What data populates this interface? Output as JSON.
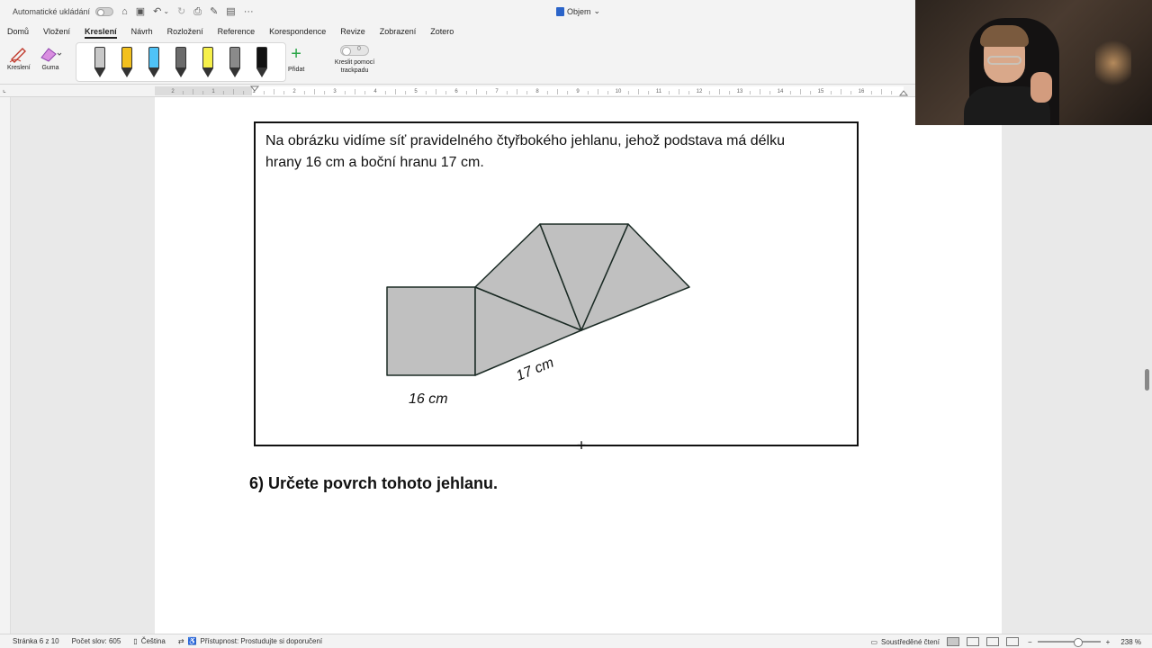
{
  "titlebar": {
    "autosave_label": "Automatické ukládání",
    "more_label": "···",
    "document_title": "Objem",
    "document_title_chevron": "⌄"
  },
  "tabs": [
    {
      "label": "Domů"
    },
    {
      "label": "Vložení"
    },
    {
      "label": "Kreslení",
      "active": true
    },
    {
      "label": "Návrh"
    },
    {
      "label": "Rozložení"
    },
    {
      "label": "Reference"
    },
    {
      "label": "Korespondence"
    },
    {
      "label": "Revize"
    },
    {
      "label": "Zobrazení"
    },
    {
      "label": "Zotero"
    }
  ],
  "ribbon": {
    "draw_label": "Kreslení",
    "eraser_label": "Guma",
    "add_label": "Přidat",
    "trackpad_toggle_state": "0",
    "trackpad_label": "Kreslit pomocí trackpadu",
    "pens": [
      {
        "name": "pencil-gray",
        "color": "#c8c8c8"
      },
      {
        "name": "pen-yellow",
        "color": "#f2c01e"
      },
      {
        "name": "pen-cyan",
        "color": "#4fc3f7"
      },
      {
        "name": "pencil-dark",
        "color": "#6b6b6b"
      },
      {
        "name": "highlighter-yellow",
        "color": "#f6f04a"
      },
      {
        "name": "pencil-gray2",
        "color": "#8a8a8a"
      },
      {
        "name": "pen-black",
        "color": "#111111"
      }
    ]
  },
  "ruler": {
    "labels": [
      "2",
      "1",
      "1",
      "2",
      "3",
      "4",
      "5",
      "6",
      "7",
      "8",
      "9",
      "10",
      "11",
      "12",
      "13",
      "14",
      "15",
      "16"
    ]
  },
  "document": {
    "problem_line1": "Na obrázku vidíme síť pravidelného čtyřbokého jehlanu, jehož podstava má délku",
    "problem_line2": "hrany 16 cm a boční hranu 17 cm.",
    "label_base": "16 cm",
    "label_side": "17 cm",
    "question": "6)  Určete povrch tohoto jehlanu."
  },
  "statusbar": {
    "page": "Stránka 6 z 10",
    "words": "Počet slov: 605",
    "language": "Čeština",
    "accessibility": "Přístupnost: Prostudujte si doporučení",
    "focus": "Soustředěné čtení",
    "zoom_minus": "−",
    "zoom_plus": "+",
    "zoom": "238 %"
  },
  "colors": {
    "net_fill": "#c0c0c0",
    "net_stroke": "#1a2a24",
    "accent_tab_underline": "#222222"
  }
}
